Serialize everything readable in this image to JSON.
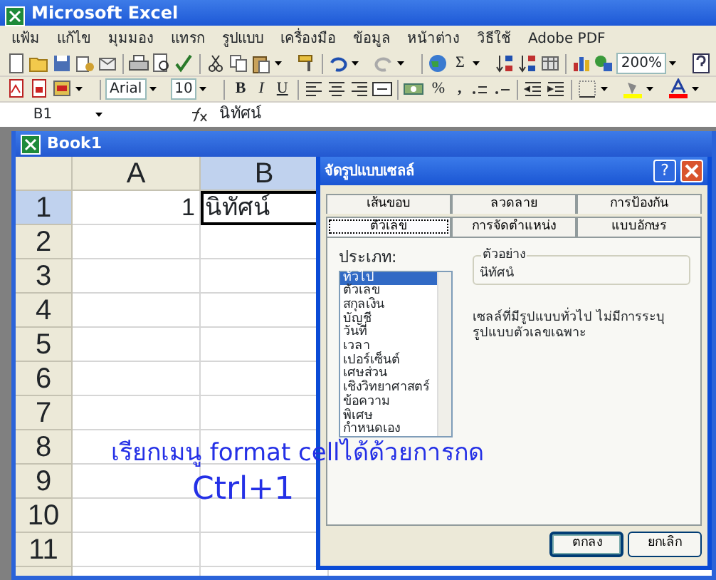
{
  "app": {
    "title": "Microsoft Excel"
  },
  "menu": [
    "แฟ้ม",
    "แก้ไข",
    "มุมมอง",
    "แทรก",
    "รูปแบบ",
    "เครื่องมือ",
    "ข้อมูล",
    "หน้าต่าง",
    "วิธีใช้",
    "Adobe PDF"
  ],
  "toolbar_standard": {
    "sum": "Σ",
    "zoom": "200%"
  },
  "toolbar_formatting": {
    "font": "Arial",
    "size": "10",
    "bold": "B",
    "italic": "I",
    "underline": "U",
    "percent": "%",
    "comma": ","
  },
  "formula_bar": {
    "name_box": "B1",
    "content": "นิทัศน์"
  },
  "workbook": {
    "title": "Book1",
    "columns": [
      {
        "label": "A",
        "selected": false
      },
      {
        "label": "B",
        "selected": true
      }
    ],
    "rows": [
      {
        "label": "1",
        "selected": true,
        "cells": [
          {
            "value": "1",
            "selected": false
          },
          {
            "value": "นิทัศน์",
            "selected": true
          }
        ]
      },
      {
        "label": "2",
        "selected": false
      },
      {
        "label": "3",
        "selected": false
      },
      {
        "label": "4",
        "selected": false
      },
      {
        "label": "5",
        "selected": false
      },
      {
        "label": "6",
        "selected": false
      },
      {
        "label": "7",
        "selected": false
      },
      {
        "label": "8",
        "selected": false
      },
      {
        "label": "9",
        "selected": false
      },
      {
        "label": "10",
        "selected": false
      },
      {
        "label": "11",
        "selected": false
      }
    ]
  },
  "dialog": {
    "title": "จัดรูปแบบเซลล์",
    "help": "?",
    "tab_rows": [
      [
        {
          "label": "เส้นขอบ",
          "selected": false
        },
        {
          "label": "ลวดลาย",
          "selected": false
        },
        {
          "label": "การป้องกัน",
          "selected": false
        }
      ],
      [
        {
          "label": "ตัวเลข",
          "selected": true
        },
        {
          "label": "การจัดตำแหน่ง",
          "selected": false
        },
        {
          "label": "แบบอักษร",
          "selected": false
        }
      ]
    ],
    "category_label": "ประเภท:",
    "categories": [
      {
        "label": "ทั่วไป",
        "selected": true
      },
      {
        "label": "ตัวเลข",
        "selected": false
      },
      {
        "label": "สกุลเงิน",
        "selected": false
      },
      {
        "label": "บัญชี",
        "selected": false
      },
      {
        "label": "วันที่",
        "selected": false
      },
      {
        "label": "เวลา",
        "selected": false
      },
      {
        "label": "เปอร์เซ็นต์",
        "selected": false
      },
      {
        "label": "เศษส่วน",
        "selected": false
      },
      {
        "label": "เชิงวิทยาศาสตร์",
        "selected": false
      },
      {
        "label": "ข้อความ",
        "selected": false
      },
      {
        "label": "พิเศษ",
        "selected": false
      },
      {
        "label": "กำหนดเอง",
        "selected": false
      }
    ],
    "sample": {
      "legend": "ตัวอย่าง",
      "value": "นิทัศน์"
    },
    "description": "เซลล์ที่มีรูปแบบทั่วไป ไม่มีการระบุรูปแบบตัวเลขเฉพาะ",
    "buttons": [
      {
        "label": "ตกลง",
        "default": true
      },
      {
        "label": "ยกเลิก",
        "default": false
      }
    ]
  },
  "annotation": [
    "เรียกเมนู format cellได้ด้วยการกด",
    "Ctrl+1"
  ]
}
